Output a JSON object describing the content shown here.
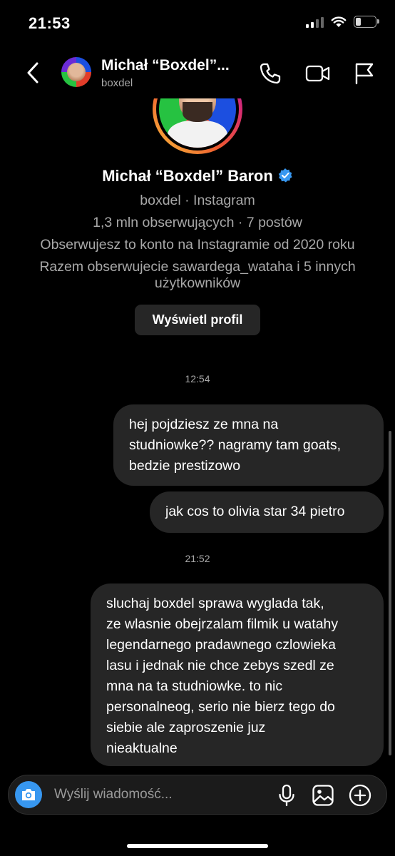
{
  "status_bar": {
    "time": "21:53",
    "battery_level": "24",
    "battery_fraction": 0.24
  },
  "header": {
    "name": "Michał “Boxdel”...",
    "username": "boxdel",
    "icons": [
      "back-icon",
      "phone-icon",
      "video-camera-icon",
      "flag-icon"
    ]
  },
  "profile": {
    "full_name": "Michał “Boxdel” Baron",
    "source": "boxdel · Instagram",
    "stats": "1,3 mln obserwujących · 7 postów",
    "following_since": "Obserwujesz to konto na Instagramie od 2020 roku",
    "mutual_line1": "Razem obserwujecie sawardega_wataha i 5 innych",
    "mutual_line2": "użytkowników",
    "view_profile_label": "Wyświetl profil"
  },
  "chat": {
    "timestamps": [
      "12:54",
      "21:52"
    ],
    "messages": [
      {
        "text": "hej pojdziesz ze mna na\nstudniowke?? nagramy tam goats,\nbedzie prestizowo",
        "sender": "me"
      },
      {
        "text": "jak cos to olivia star 34 pietro",
        "sender": "me"
      },
      {
        "text": "sluchaj boxdel sprawa wyglada tak,\nze wlasnie obejrzalam filmik u watahy\nlegendarnego pradawnego czlowieka\nlasu i jednak nie chce zebys szedl ze\nmna na ta studniowke. to nic\npersonalneog, serio nie bierz tego do\nsiebie ale zaproszenie juz\nnieaktualne",
        "sender": "me"
      }
    ]
  },
  "composer": {
    "placeholder": "Wyślij wiadomość...",
    "icons": [
      "camera-icon",
      "microphone-icon",
      "gallery-icon",
      "add-icon"
    ]
  },
  "colors": {
    "background": "#000000",
    "bubble": "#262626",
    "accent": "#3797f0",
    "secondary_text": "#a8a8a8"
  }
}
